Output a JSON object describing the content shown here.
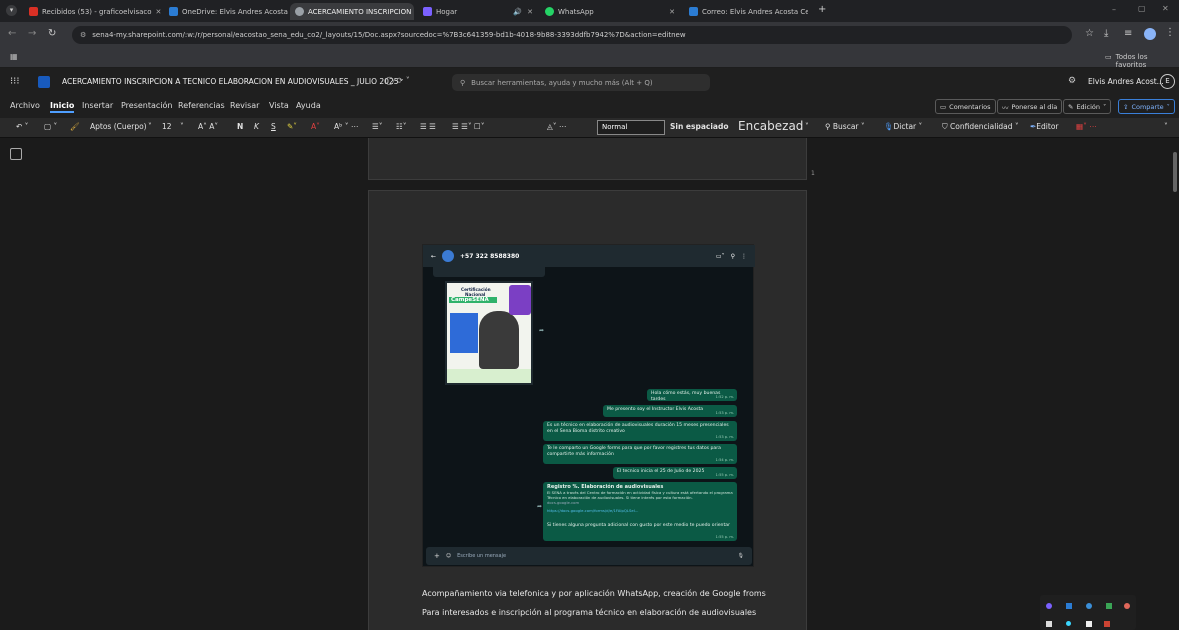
{
  "browser": {
    "tabs": [
      {
        "title": "Recibidos (53) - graficoelvisaco",
        "color": "#d93025"
      },
      {
        "title": "OneDrive: Elvis Andres Acosta",
        "color": "#2b7cd3"
      },
      {
        "title": "ACERCAMIENTO INSCRIPCION",
        "color": "#9aa0a6",
        "active": true
      },
      {
        "title": "Hogar",
        "color": "#7b61ff"
      },
      {
        "title": "",
        "color": "#9aa0a6"
      },
      {
        "title": "WhatsApp",
        "color": "#25d366"
      },
      {
        "title": "Correo: Elvis Andres Acosta Ce",
        "color": "#2b7cd3"
      }
    ],
    "new_tab": "+",
    "url": "sena4-my.sharepoint.com/:w:/r/personal/eacostao_sena_edu_co2/_layouts/15/Doc.aspx?sourcedoc=%7B3c641359-bd1b-4018-9b88-3393ddfb7942%7D&action=editnew",
    "bookmarks_folder": "Todos los favoritos"
  },
  "word": {
    "doc_title": "ACERCAMIENTO INSCRIPCION A TECNICO ELABORACION EN AUDIOVISUALES _ JULIO 2025",
    "search_placeholder": "Buscar herramientas, ayuda y mucho más (Alt + Q)",
    "user_name": "Elvis Andres Acost...",
    "user_initial": "E",
    "menus": [
      "Archivo",
      "Inicio",
      "Insertar",
      "Presentación",
      "Referencias",
      "Revisar",
      "Vista",
      "Ayuda"
    ],
    "active_menu": "Inicio",
    "right_buttons": {
      "comments": "Comentarios",
      "catch_up": "Ponerse al día",
      "editing": "Edición",
      "share": "Comparte"
    },
    "ribbon": {
      "font": "Aptos (Cuerpo)",
      "size": "12",
      "style_normal": "Normal",
      "style_nospace": "Sin espaciado",
      "style_heading": "Encabezad",
      "buscar": "Buscar",
      "dictar": "Dictar",
      "confidencialidad": "Confidencialidad",
      "editor": "Editor"
    },
    "page_number_marker": "1",
    "doc_lines": [
      "Acompañamiento via telefonica y por aplicación WhatsApp, creación de Google froms",
      "Para interesados e inscripción al programa técnico en elaboración de audiovisuales"
    ]
  },
  "whatsapp": {
    "contact": "+57 322 8588380",
    "poster": {
      "line1": "Certificación",
      "line2": "Nacional",
      "line3": "CampeSENA"
    },
    "messages": [
      {
        "text": "Hola cómo estás, muy buenas tardes",
        "time": "1:52 p. m."
      },
      {
        "text": "Me presento soy el Instructor Elvis Acosta",
        "time": "1:53 p. m."
      },
      {
        "text": "Es un técnico en elaboración de audiovisuales duración 15 meses presenciales en el Sena Bioma distrito creativo",
        "time": "1:53 p. m."
      },
      {
        "text": "Te le comparto un Google forms para que por favor registres tus datos para compartirte más información",
        "time": "1:54 p. m."
      },
      {
        "text": "El tecnico inicia el 25 de Julio de 2025",
        "time": "1:55 p. m."
      },
      {
        "text": "Si tienes alguna pregunta adicional con gusto por este medio te puedo orientar",
        "time": "1:55 p. m."
      }
    ],
    "form_card": {
      "title": "Registro %. Elaboración de audiovisuales",
      "body": "El SENA a través del Centro de formación en actividad física y cultura está ofertando el programa Técnico en elaboración de audiovisuales. Si tiene interés por esta formación.",
      "domain": "docs.google.com",
      "link": "https://docs.google.com/forms/d/e/1FAIpQLSeI..."
    },
    "composer_placeholder": "Escribe un mensaje"
  }
}
